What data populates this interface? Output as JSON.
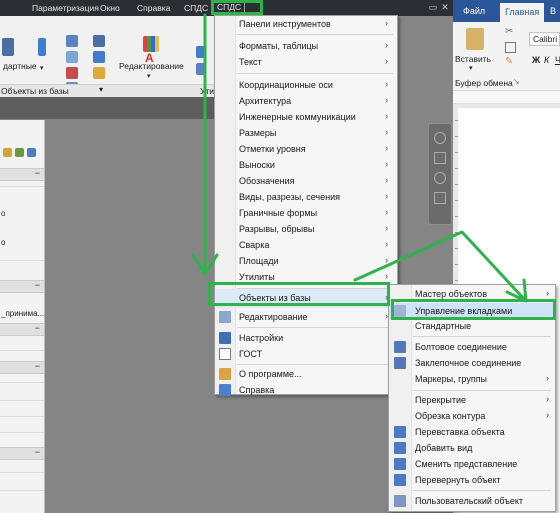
{
  "topbar": {
    "menus": [
      "Параметризация",
      "Окно",
      "Справка",
      "СПДС",
      "СПДС"
    ],
    "window_buttons": [
      "▭",
      "✕"
    ]
  },
  "ribbon": {
    "labels": {
      "dartnye": "дартные",
      "redaktirovanie": "Редактирование",
      "objects_from_db": "Объекты из базы",
      "uti": "Ути"
    }
  },
  "left_palette": {
    "texts": [
      "о",
      "о",
      "_принима..."
    ],
    "minus": "−"
  },
  "menu": {
    "items": [
      {
        "label": "Панели инструментов",
        "arrow": "›"
      },
      {
        "label": "Форматы, таблицы",
        "arrow": "›"
      },
      {
        "label": "Текст",
        "arrow": "›"
      },
      {
        "label": "Координационные оси",
        "arrow": "›"
      },
      {
        "label": "Архитектура",
        "arrow": "›"
      },
      {
        "label": "Инженерные коммуникации",
        "arrow": "›"
      },
      {
        "label": "Размеры",
        "arrow": "›"
      },
      {
        "label": "Отметки уровня",
        "arrow": "›"
      },
      {
        "label": "Выноски",
        "arrow": "›"
      },
      {
        "label": "Обозначения",
        "arrow": "›"
      },
      {
        "label": "Виды, разрезы, сечения",
        "arrow": "›"
      },
      {
        "label": "Граничные формы",
        "arrow": "›"
      },
      {
        "label": "Разрывы, обрывы",
        "arrow": "›"
      },
      {
        "label": "Сварка",
        "arrow": "›"
      },
      {
        "label": "Площади",
        "arrow": "›"
      },
      {
        "label": "Утилиты",
        "arrow": "›"
      },
      {
        "label": "Объекты из базы",
        "arrow": "›"
      },
      {
        "label": "Редактирование",
        "arrow": "›"
      },
      {
        "label": "Настройки",
        "arrow": ""
      },
      {
        "label": "ГОСТ",
        "arrow": ""
      },
      {
        "label": "О программе...",
        "arrow": ""
      },
      {
        "label": "Справка",
        "arrow": ""
      }
    ]
  },
  "submenu": {
    "items": [
      {
        "label": "Мастер объектов",
        "arrow": "›"
      },
      {
        "label": "Управление вкладками",
        "arrow": ""
      },
      {
        "label": "Стандартные",
        "arrow": ""
      },
      {
        "label": "Болтовое соединение",
        "arrow": ""
      },
      {
        "label": "Заклепочное соединение",
        "arrow": ""
      },
      {
        "label": "Маркеры, группы",
        "arrow": "›"
      },
      {
        "label": "Перекрытие",
        "arrow": "›"
      },
      {
        "label": "Обрезка контура",
        "arrow": "›"
      },
      {
        "label": "Перевставка объекта",
        "arrow": ""
      },
      {
        "label": "Добавить вид",
        "arrow": ""
      },
      {
        "label": "Сменить представление",
        "arrow": ""
      },
      {
        "label": "Перевернуть объект",
        "arrow": ""
      },
      {
        "label": "Пользовательский объект",
        "arrow": ""
      }
    ]
  },
  "word": {
    "tabs": [
      "Файл",
      "Главная",
      "В"
    ],
    "font": "Calibri",
    "buttons": {
      "paste": "Вставить",
      "bold": "Ж",
      "italic": "К",
      "underline": "Ч"
    },
    "group": "Буфер обмена"
  },
  "colors": {
    "annotation_green": "#2eb24a",
    "highlight": "#cfe3f8",
    "word_blue": "#2b579a"
  }
}
